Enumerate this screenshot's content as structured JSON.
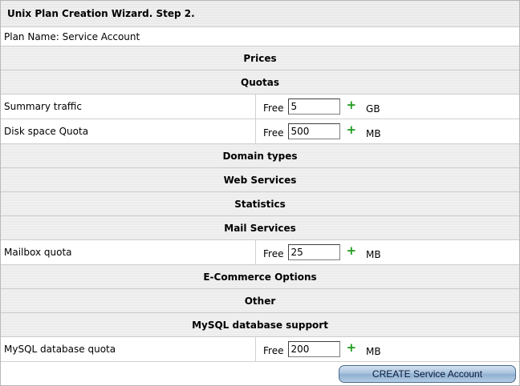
{
  "title": "Unix Plan Creation Wizard. Step 2.",
  "plan_name": "Plan Name: Service Account",
  "sections": {
    "prices": "Prices",
    "quotas": "Quotas",
    "domain_types": "Domain types",
    "web_services": "Web Services",
    "statistics": "Statistics",
    "mail_services": "Mail Services",
    "ecommerce": "E-Commerce Options",
    "other": "Other",
    "mysql": "MySQL database support"
  },
  "fields": {
    "summary_traffic": {
      "label": "Summary traffic",
      "free": "Free",
      "value": "5",
      "plus": "+",
      "unit": "GB"
    },
    "disk_space": {
      "label": "Disk space Quota",
      "free": "Free",
      "value": "500",
      "plus": "+",
      "unit": "MB"
    },
    "mailbox_quota": {
      "label": "Mailbox quota",
      "free": "Free",
      "value": "25",
      "plus": "+",
      "unit": "MB"
    },
    "mysql_quota": {
      "label": "MySQL database quota",
      "free": "Free",
      "value": "200",
      "plus": "+",
      "unit": "MB"
    }
  },
  "create_button": "CREATE Service Account",
  "colors": {
    "plus": "#1a9a1a",
    "button": "#8fb0d2"
  },
  "icons": {
    "plus": "plus-icon"
  }
}
